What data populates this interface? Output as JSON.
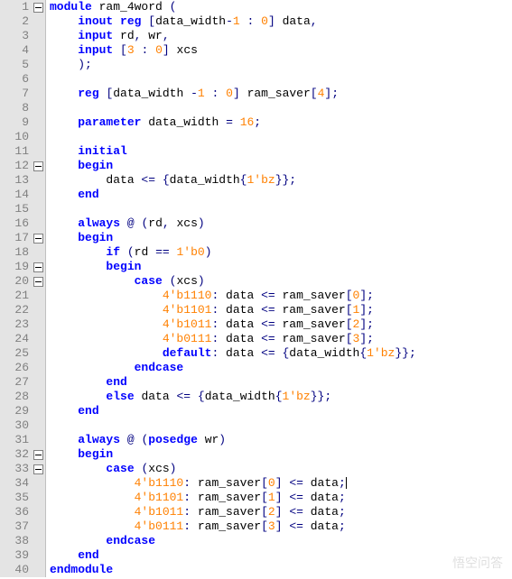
{
  "lines": [
    {
      "n": 1,
      "fold": "minus",
      "tokens": [
        [
          "kw",
          "module"
        ],
        [
          "id",
          " ram_4word "
        ],
        [
          "op",
          "("
        ]
      ]
    },
    {
      "n": 2,
      "fold": "",
      "tokens": [
        [
          "id",
          "    "
        ],
        [
          "kw",
          "inout"
        ],
        [
          "id",
          " "
        ],
        [
          "kw",
          "reg"
        ],
        [
          "id",
          " "
        ],
        [
          "op",
          "["
        ],
        [
          "id",
          "data_width"
        ],
        [
          "op",
          "-"
        ],
        [
          "num",
          "1"
        ],
        [
          "id",
          " "
        ],
        [
          "op",
          ":"
        ],
        [
          "id",
          " "
        ],
        [
          "num",
          "0"
        ],
        [
          "op",
          "]"
        ],
        [
          "id",
          " data"
        ],
        [
          "op",
          ","
        ]
      ]
    },
    {
      "n": 3,
      "fold": "",
      "tokens": [
        [
          "id",
          "    "
        ],
        [
          "kw",
          "input"
        ],
        [
          "id",
          " rd"
        ],
        [
          "op",
          ","
        ],
        [
          "id",
          " wr"
        ],
        [
          "op",
          ","
        ]
      ]
    },
    {
      "n": 4,
      "fold": "",
      "tokens": [
        [
          "id",
          "    "
        ],
        [
          "kw",
          "input"
        ],
        [
          "id",
          " "
        ],
        [
          "op",
          "["
        ],
        [
          "num",
          "3"
        ],
        [
          "id",
          " "
        ],
        [
          "op",
          ":"
        ],
        [
          "id",
          " "
        ],
        [
          "num",
          "0"
        ],
        [
          "op",
          "]"
        ],
        [
          "id",
          " xcs"
        ]
      ]
    },
    {
      "n": 5,
      "fold": "",
      "tokens": [
        [
          "id",
          "    "
        ],
        [
          "op",
          ");"
        ]
      ]
    },
    {
      "n": 6,
      "fold": "",
      "tokens": []
    },
    {
      "n": 7,
      "fold": "",
      "tokens": [
        [
          "id",
          "    "
        ],
        [
          "kw",
          "reg"
        ],
        [
          "id",
          " "
        ],
        [
          "op",
          "["
        ],
        [
          "id",
          "data_width "
        ],
        [
          "op",
          "-"
        ],
        [
          "num",
          "1"
        ],
        [
          "id",
          " "
        ],
        [
          "op",
          ":"
        ],
        [
          "id",
          " "
        ],
        [
          "num",
          "0"
        ],
        [
          "op",
          "]"
        ],
        [
          "id",
          " ram_saver"
        ],
        [
          "op",
          "["
        ],
        [
          "num",
          "4"
        ],
        [
          "op",
          "];"
        ]
      ]
    },
    {
      "n": 8,
      "fold": "",
      "tokens": []
    },
    {
      "n": 9,
      "fold": "",
      "tokens": [
        [
          "id",
          "    "
        ],
        [
          "kw",
          "parameter"
        ],
        [
          "id",
          " data_width "
        ],
        [
          "op",
          "="
        ],
        [
          "id",
          " "
        ],
        [
          "num",
          "16"
        ],
        [
          "op",
          ";"
        ]
      ]
    },
    {
      "n": 10,
      "fold": "",
      "tokens": []
    },
    {
      "n": 11,
      "fold": "",
      "tokens": [
        [
          "id",
          "    "
        ],
        [
          "kw",
          "initial"
        ]
      ]
    },
    {
      "n": 12,
      "fold": "minus",
      "tokens": [
        [
          "id",
          "    "
        ],
        [
          "kw",
          "begin"
        ]
      ]
    },
    {
      "n": 13,
      "fold": "",
      "tokens": [
        [
          "id",
          "        data "
        ],
        [
          "op",
          "<="
        ],
        [
          "id",
          " "
        ],
        [
          "op",
          "{"
        ],
        [
          "id",
          "data_width"
        ],
        [
          "op",
          "{"
        ],
        [
          "num",
          "1'bz"
        ],
        [
          "op",
          "}};"
        ]
      ]
    },
    {
      "n": 14,
      "fold": "",
      "tokens": [
        [
          "id",
          "    "
        ],
        [
          "kw",
          "end"
        ]
      ]
    },
    {
      "n": 15,
      "fold": "",
      "tokens": []
    },
    {
      "n": 16,
      "fold": "",
      "tokens": [
        [
          "id",
          "    "
        ],
        [
          "kw",
          "always"
        ],
        [
          "id",
          " "
        ],
        [
          "op",
          "@"
        ],
        [
          "id",
          " "
        ],
        [
          "op",
          "("
        ],
        [
          "id",
          "rd"
        ],
        [
          "op",
          ","
        ],
        [
          "id",
          " xcs"
        ],
        [
          "op",
          ")"
        ]
      ]
    },
    {
      "n": 17,
      "fold": "minus",
      "tokens": [
        [
          "id",
          "    "
        ],
        [
          "kw",
          "begin"
        ]
      ]
    },
    {
      "n": 18,
      "fold": "",
      "tokens": [
        [
          "id",
          "        "
        ],
        [
          "kw",
          "if"
        ],
        [
          "id",
          " "
        ],
        [
          "op",
          "("
        ],
        [
          "id",
          "rd "
        ],
        [
          "op",
          "=="
        ],
        [
          "id",
          " "
        ],
        [
          "num",
          "1'b0"
        ],
        [
          "op",
          ")"
        ]
      ]
    },
    {
      "n": 19,
      "fold": "minus",
      "tokens": [
        [
          "id",
          "        "
        ],
        [
          "kw",
          "begin"
        ]
      ]
    },
    {
      "n": 20,
      "fold": "minus",
      "tokens": [
        [
          "id",
          "            "
        ],
        [
          "kw",
          "case"
        ],
        [
          "id",
          " "
        ],
        [
          "op",
          "("
        ],
        [
          "id",
          "xcs"
        ],
        [
          "op",
          ")"
        ]
      ]
    },
    {
      "n": 21,
      "fold": "",
      "tokens": [
        [
          "id",
          "                "
        ],
        [
          "num",
          "4'b1110"
        ],
        [
          "op",
          ":"
        ],
        [
          "id",
          " data "
        ],
        [
          "op",
          "<="
        ],
        [
          "id",
          " ram_saver"
        ],
        [
          "op",
          "["
        ],
        [
          "num",
          "0"
        ],
        [
          "op",
          "];"
        ]
      ]
    },
    {
      "n": 22,
      "fold": "",
      "tokens": [
        [
          "id",
          "                "
        ],
        [
          "num",
          "4'b1101"
        ],
        [
          "op",
          ":"
        ],
        [
          "id",
          " data "
        ],
        [
          "op",
          "<="
        ],
        [
          "id",
          " ram_saver"
        ],
        [
          "op",
          "["
        ],
        [
          "num",
          "1"
        ],
        [
          "op",
          "];"
        ]
      ]
    },
    {
      "n": 23,
      "fold": "",
      "tokens": [
        [
          "id",
          "                "
        ],
        [
          "num",
          "4'b1011"
        ],
        [
          "op",
          ":"
        ],
        [
          "id",
          " data "
        ],
        [
          "op",
          "<="
        ],
        [
          "id",
          " ram_saver"
        ],
        [
          "op",
          "["
        ],
        [
          "num",
          "2"
        ],
        [
          "op",
          "];"
        ]
      ]
    },
    {
      "n": 24,
      "fold": "",
      "tokens": [
        [
          "id",
          "                "
        ],
        [
          "num",
          "4'b0111"
        ],
        [
          "op",
          ":"
        ],
        [
          "id",
          " data "
        ],
        [
          "op",
          "<="
        ],
        [
          "id",
          " ram_saver"
        ],
        [
          "op",
          "["
        ],
        [
          "num",
          "3"
        ],
        [
          "op",
          "];"
        ]
      ]
    },
    {
      "n": 25,
      "fold": "",
      "tokens": [
        [
          "id",
          "                "
        ],
        [
          "kw",
          "default"
        ],
        [
          "op",
          ":"
        ],
        [
          "id",
          " data "
        ],
        [
          "op",
          "<="
        ],
        [
          "id",
          " "
        ],
        [
          "op",
          "{"
        ],
        [
          "id",
          "data_width"
        ],
        [
          "op",
          "{"
        ],
        [
          "num",
          "1'bz"
        ],
        [
          "op",
          "}};"
        ]
      ]
    },
    {
      "n": 26,
      "fold": "",
      "tokens": [
        [
          "id",
          "            "
        ],
        [
          "kw",
          "endcase"
        ]
      ]
    },
    {
      "n": 27,
      "fold": "",
      "tokens": [
        [
          "id",
          "        "
        ],
        [
          "kw",
          "end"
        ]
      ]
    },
    {
      "n": 28,
      "fold": "",
      "tokens": [
        [
          "id",
          "        "
        ],
        [
          "kw",
          "else"
        ],
        [
          "id",
          " data "
        ],
        [
          "op",
          "<="
        ],
        [
          "id",
          " "
        ],
        [
          "op",
          "{"
        ],
        [
          "id",
          "data_width"
        ],
        [
          "op",
          "{"
        ],
        [
          "num",
          "1'bz"
        ],
        [
          "op",
          "}};"
        ]
      ]
    },
    {
      "n": 29,
      "fold": "",
      "tokens": [
        [
          "id",
          "    "
        ],
        [
          "kw",
          "end"
        ]
      ]
    },
    {
      "n": 30,
      "fold": "",
      "tokens": []
    },
    {
      "n": 31,
      "fold": "",
      "tokens": [
        [
          "id",
          "    "
        ],
        [
          "kw",
          "always"
        ],
        [
          "id",
          " "
        ],
        [
          "op",
          "@"
        ],
        [
          "id",
          " "
        ],
        [
          "op",
          "("
        ],
        [
          "kw",
          "posedge"
        ],
        [
          "id",
          " wr"
        ],
        [
          "op",
          ")"
        ]
      ]
    },
    {
      "n": 32,
      "fold": "minus",
      "tokens": [
        [
          "id",
          "    "
        ],
        [
          "kw",
          "begin"
        ]
      ]
    },
    {
      "n": 33,
      "fold": "minus",
      "tokens": [
        [
          "id",
          "        "
        ],
        [
          "kw",
          "case"
        ],
        [
          "id",
          " "
        ],
        [
          "op",
          "("
        ],
        [
          "id",
          "xcs"
        ],
        [
          "op",
          ")"
        ]
      ]
    },
    {
      "n": 34,
      "fold": "",
      "cursor": true,
      "tokens": [
        [
          "id",
          "            "
        ],
        [
          "num",
          "4'b1110"
        ],
        [
          "op",
          ":"
        ],
        [
          "id",
          " ram_saver"
        ],
        [
          "op",
          "["
        ],
        [
          "num",
          "0"
        ],
        [
          "op",
          "]"
        ],
        [
          "id",
          " "
        ],
        [
          "op",
          "<="
        ],
        [
          "id",
          " data"
        ],
        [
          "op",
          ";"
        ]
      ]
    },
    {
      "n": 35,
      "fold": "",
      "tokens": [
        [
          "id",
          "            "
        ],
        [
          "num",
          "4'b1101"
        ],
        [
          "op",
          ":"
        ],
        [
          "id",
          " ram_saver"
        ],
        [
          "op",
          "["
        ],
        [
          "num",
          "1"
        ],
        [
          "op",
          "]"
        ],
        [
          "id",
          " "
        ],
        [
          "op",
          "<="
        ],
        [
          "id",
          " data"
        ],
        [
          "op",
          ";"
        ]
      ]
    },
    {
      "n": 36,
      "fold": "",
      "tokens": [
        [
          "id",
          "            "
        ],
        [
          "num",
          "4'b1011"
        ],
        [
          "op",
          ":"
        ],
        [
          "id",
          " ram_saver"
        ],
        [
          "op",
          "["
        ],
        [
          "num",
          "2"
        ],
        [
          "op",
          "]"
        ],
        [
          "id",
          " "
        ],
        [
          "op",
          "<="
        ],
        [
          "id",
          " data"
        ],
        [
          "op",
          ";"
        ]
      ]
    },
    {
      "n": 37,
      "fold": "",
      "tokens": [
        [
          "id",
          "            "
        ],
        [
          "num",
          "4'b0111"
        ],
        [
          "op",
          ":"
        ],
        [
          "id",
          " ram_saver"
        ],
        [
          "op",
          "["
        ],
        [
          "num",
          "3"
        ],
        [
          "op",
          "]"
        ],
        [
          "id",
          " "
        ],
        [
          "op",
          "<="
        ],
        [
          "id",
          " data"
        ],
        [
          "op",
          ";"
        ]
      ]
    },
    {
      "n": 38,
      "fold": "",
      "tokens": [
        [
          "id",
          "        "
        ],
        [
          "kw",
          "endcase"
        ]
      ]
    },
    {
      "n": 39,
      "fold": "",
      "tokens": [
        [
          "id",
          "    "
        ],
        [
          "kw",
          "end"
        ]
      ]
    },
    {
      "n": 40,
      "fold": "",
      "tokens": [
        [
          "kw",
          "endmodule"
        ]
      ]
    }
  ],
  "watermark": "悟空问答"
}
